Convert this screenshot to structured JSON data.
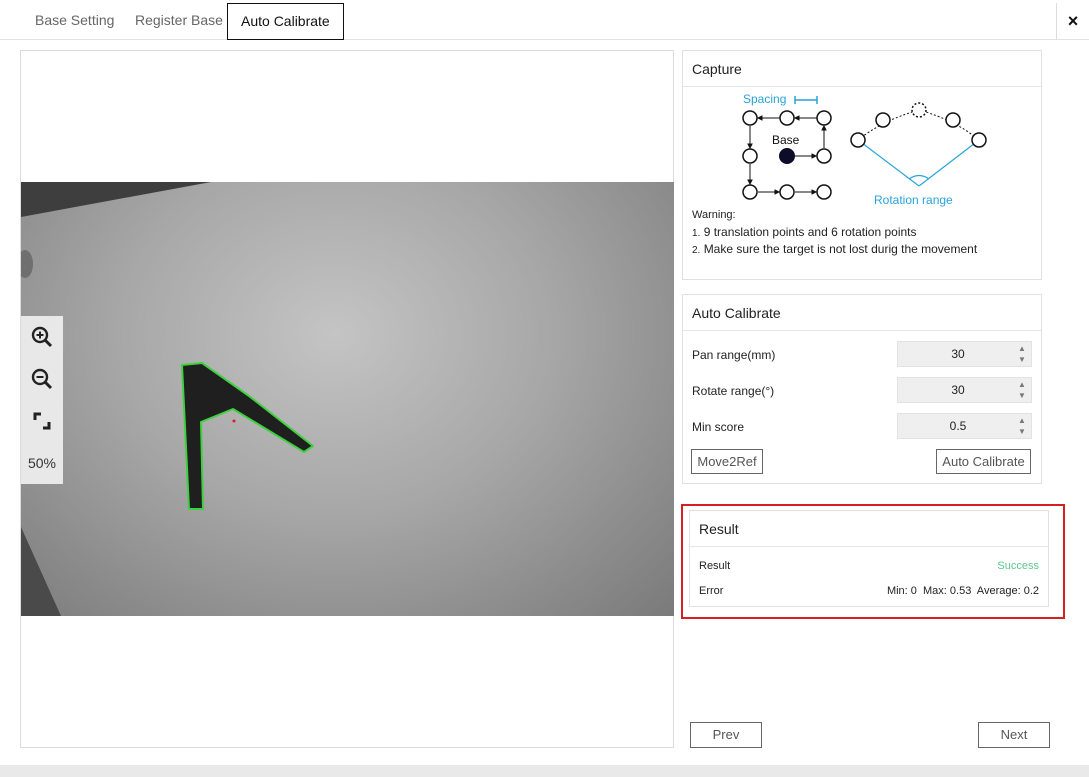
{
  "tabs": [
    {
      "label": "Base Setting"
    },
    {
      "label": "Register Base"
    },
    {
      "label": "Auto Calibrate"
    }
  ],
  "close_icon": "×",
  "viewer": {
    "zoom_level": "50%",
    "tools": [
      "zoom-in-icon",
      "zoom-out-icon",
      "fit-icon"
    ]
  },
  "capture": {
    "title": "Capture",
    "diagram": {
      "spacing_label": "Spacing",
      "base_label": "Base",
      "rotation_label": "Rotation range"
    },
    "warning_title": "Warning:",
    "warnings": [
      {
        "num": "1.",
        "text": "9 translation points and 6 rotation points"
      },
      {
        "num": "2.",
        "text": "Make sure the target is not lost durig the movement"
      }
    ]
  },
  "auto_calibrate": {
    "title": "Auto Calibrate",
    "fields": [
      {
        "label": "Pan range(mm)",
        "value": "30"
      },
      {
        "label": "Rotate range(°)",
        "value": "30"
      },
      {
        "label": "Min score",
        "value": "0.5"
      }
    ],
    "move2ref_label": "Move2Ref",
    "auto_calibrate_label": "Auto Calibrate"
  },
  "result": {
    "title": "Result",
    "result_label": "Result",
    "result_value": "Success",
    "error_label": "Error",
    "error_value": "Min: 0  Max: 0.53  Average: 0.2"
  },
  "nav": {
    "prev_label": "Prev",
    "next_label": "Next"
  },
  "colors": {
    "accent_blue": "#29a3d9",
    "success_green": "#5cc98c",
    "highlight_red": "#d42020",
    "contour_green": "#3ed13e"
  }
}
